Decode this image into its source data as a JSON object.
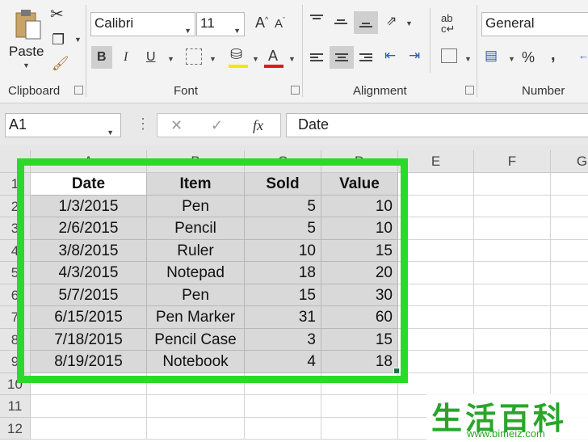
{
  "ribbon": {
    "clipboard": {
      "paste_label": "Paste",
      "group_label": "Clipboard"
    },
    "font": {
      "name": "Calibri",
      "size": "11",
      "group_label": "Font",
      "bold": "B",
      "italic": "I",
      "underline": "U",
      "grow": "A",
      "shrink": "A",
      "color_letter": "A"
    },
    "alignment": {
      "group_label": "Alignment"
    },
    "number": {
      "format": "General",
      "group_label": "Number",
      "percent": "%",
      "comma": ","
    }
  },
  "formula_bar": {
    "name_box": "A1",
    "fx_label": "fx",
    "content": "Date"
  },
  "columns": [
    "A",
    "B",
    "C",
    "D",
    "E",
    "F",
    "G"
  ],
  "rows": [
    "1",
    "2",
    "3",
    "4",
    "5",
    "6",
    "7",
    "8",
    "9",
    "10",
    "11",
    "12"
  ],
  "table": {
    "headers": [
      "Date",
      "Item",
      "Sold",
      "Value"
    ],
    "rows": [
      [
        "1/3/2015",
        "Pen",
        "5",
        "10"
      ],
      [
        "2/6/2015",
        "Pencil",
        "5",
        "10"
      ],
      [
        "3/8/2015",
        "Ruler",
        "10",
        "15"
      ],
      [
        "4/3/2015",
        "Notepad",
        "18",
        "20"
      ],
      [
        "5/7/2015",
        "Pen",
        "15",
        "30"
      ],
      [
        "6/15/2015",
        "Pen Marker",
        "31",
        "60"
      ],
      [
        "7/18/2015",
        "Pencil Case",
        "3",
        "15"
      ],
      [
        "8/19/2015",
        "Notebook",
        "4",
        "18"
      ]
    ]
  },
  "colors": {
    "highlight": "#2bd92b",
    "font_color_bar": "#e0191b",
    "fill_color_bar": "#f5e600"
  },
  "watermark": {
    "text": "生活百科",
    "url": "www.bimeiz.com"
  }
}
